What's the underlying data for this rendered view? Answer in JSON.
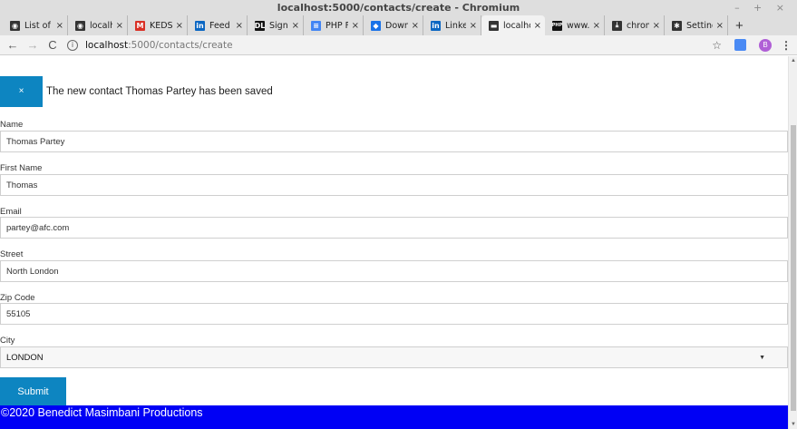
{
  "window": {
    "title": "localhost:5000/contacts/create - Chromium",
    "controls": "– + ×"
  },
  "tabs": [
    {
      "label": "List of C",
      "icon": "globe-icon",
      "color": "#333333",
      "glyph": "◉"
    },
    {
      "label": "localho",
      "icon": "globe-icon",
      "color": "#333333",
      "glyph": "◉"
    },
    {
      "label": "KEDS in",
      "icon": "gmail-icon",
      "color": "#d93025",
      "glyph": "M"
    },
    {
      "label": "Feed |",
      "icon": "linkedin-icon",
      "color": "#0a66c2",
      "glyph": "in"
    },
    {
      "label": "Signup",
      "icon": "dl-icon",
      "color": "#111111",
      "glyph": "DL"
    },
    {
      "label": "PHP Fu",
      "icon": "docs-icon",
      "color": "#4285f4",
      "glyph": "≡"
    },
    {
      "label": "Downlo",
      "icon": "download-site-icon",
      "color": "#1a73e8",
      "glyph": "◆"
    },
    {
      "label": "Linked",
      "icon": "linkedin-icon",
      "color": "#0a66c2",
      "glyph": "in"
    },
    {
      "label": "localho",
      "icon": "terminal-icon",
      "color": "#333333",
      "glyph": "▬",
      "active": true
    },
    {
      "label": "www.pl",
      "icon": "php-icon",
      "color": "#111111",
      "glyph": "PHP"
    },
    {
      "label": "chrom",
      "icon": "download-icon",
      "color": "#333333",
      "glyph": "⤓"
    },
    {
      "label": "Setting",
      "icon": "gear-icon",
      "color": "#333333",
      "glyph": "✱"
    }
  ],
  "toolbar": {
    "url_host": "localhost",
    "url_path": ":5000/contacts/create",
    "avatar_letter": "B"
  },
  "alert": {
    "close_label": "×",
    "message": "The new contact Thomas Partey has been saved"
  },
  "form": {
    "name": {
      "label": "Name",
      "value": "Thomas Partey"
    },
    "first_name": {
      "label": "First Name",
      "value": "Thomas"
    },
    "email": {
      "label": "Email",
      "value": "partey@afc.com"
    },
    "street": {
      "label": "Street",
      "value": "North London"
    },
    "zip": {
      "label": "Zip Code",
      "value": "55105"
    },
    "city": {
      "label": "City",
      "value": "LONDON"
    },
    "submit_label": "Submit"
  },
  "footer": {
    "text": "©2020 Benedict Masimbani Productions"
  },
  "colors": {
    "accent": "#0d85c1",
    "footer": "#0000f5"
  }
}
